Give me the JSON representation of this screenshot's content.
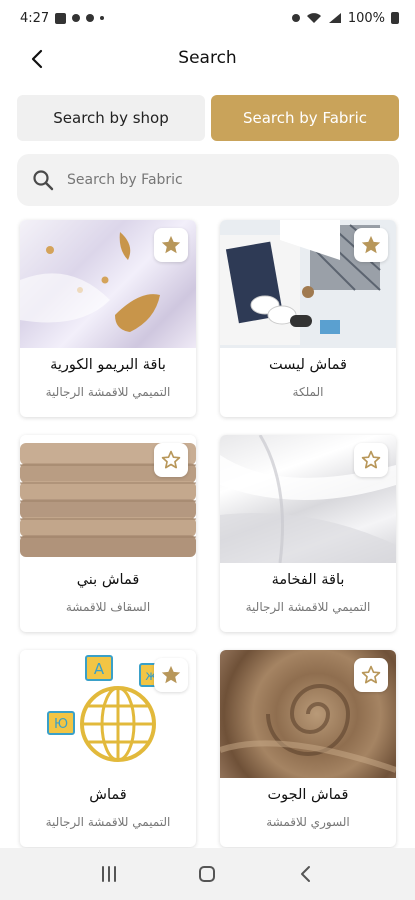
{
  "status_bar": {
    "time": "4:27",
    "battery": "100%"
  },
  "header": {
    "title": "Search"
  },
  "tabs": [
    {
      "label": "Search by shop",
      "active": false
    },
    {
      "label": "Search by Fabric",
      "active": true
    }
  ],
  "search": {
    "placeholder": "Search by Fabric",
    "value": ""
  },
  "products": [
    {
      "title": "باقة البريمو الكورية",
      "shop": "التميمي للاقمشة الرجالية",
      "image": "white-silk-with-gold-fabric"
    },
    {
      "title": "قماش ليست",
      "shop": "الملكة",
      "image": "folded-clothes-shoes-flatlay"
    },
    {
      "title": "قماش بني",
      "shop": "السقاف للاقمشة",
      "image": "stacked-beige-fabric"
    },
    {
      "title": "باقة الفخامة",
      "shop": "التميمي للاقمشة الرجالية",
      "image": "white-draped-fabric"
    },
    {
      "title": "قماش",
      "shop": "التميمي للاقمشة الرجالية",
      "image": "language-globe-illustration"
    },
    {
      "title": "قماش الجوت",
      "shop": "السوري للاقمشة",
      "image": "brown-jute-fabric-swirl"
    }
  ],
  "colors": {
    "accent": "#c9a35a",
    "tab_inactive": "#f0f0f0",
    "search_bg": "#f2f2f2",
    "star_filled": "#b8975a"
  },
  "globe_letters": [
    "A",
    "Ю",
    "ж"
  ]
}
